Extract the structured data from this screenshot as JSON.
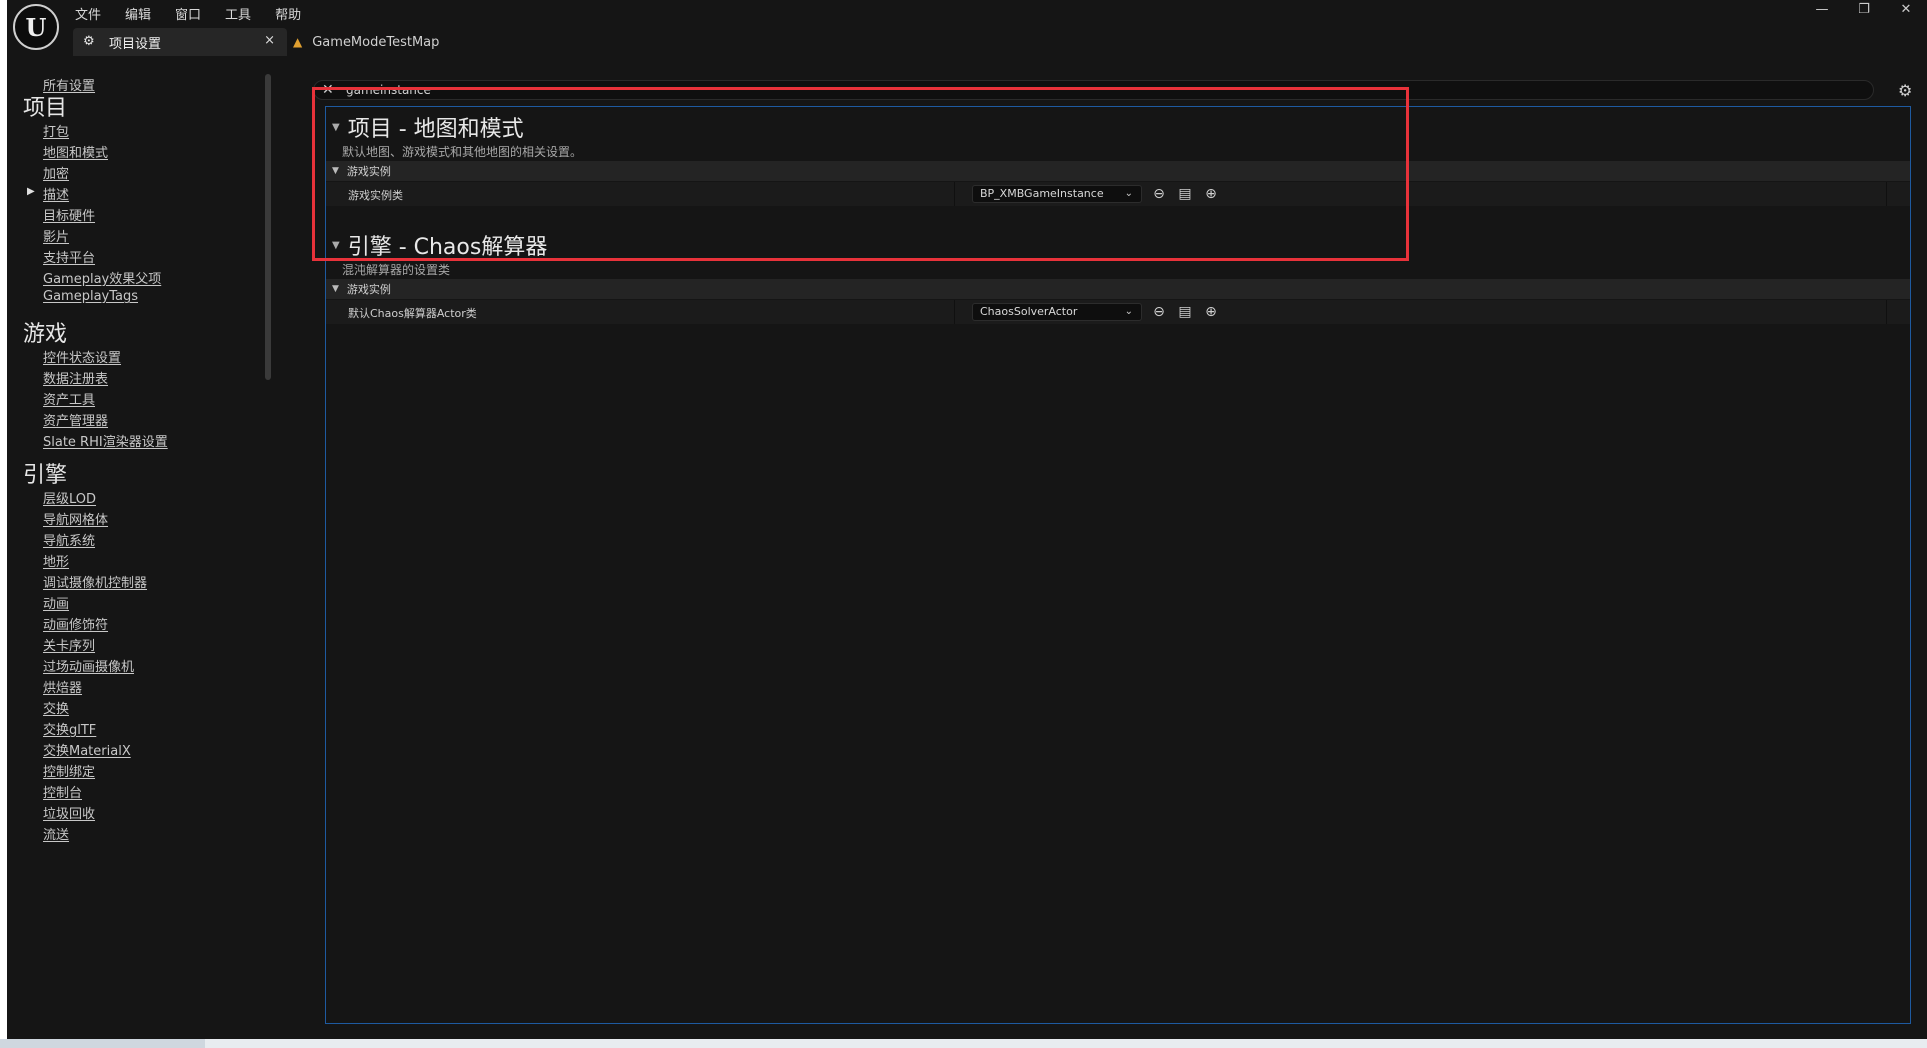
{
  "app": {
    "logo_text": "U"
  },
  "menu": [
    "文件",
    "编辑",
    "窗口",
    "工具",
    "帮助"
  ],
  "tabs": {
    "active": {
      "label": "项目设置",
      "close": "×"
    },
    "map": {
      "label": "GameModeTestMap"
    }
  },
  "window_controls": {
    "minimize": "—",
    "restore": "❐",
    "close": "✕"
  },
  "sidebar": {
    "all_settings": "所有设置",
    "project": {
      "heading": "项目",
      "items": [
        "打包",
        "地图和模式",
        "加密",
        "描述",
        "目标硬件",
        "影片",
        "支持平台",
        "Gameplay效果父项",
        "GameplayTags"
      ]
    },
    "game": {
      "heading": "游戏",
      "items": [
        "控件状态设置",
        "数据注册表",
        "资产工具",
        "资产管理器",
        "Slate RHI渲染器设置"
      ]
    },
    "engine": {
      "heading": "引擎",
      "items": [
        "层级LOD",
        "导航网格体",
        "导航系统",
        "地形",
        "调试摄像机控制器",
        "动画",
        "动画修饰符",
        "关卡序列",
        "过场动画摄像机",
        "烘焙器",
        "交换",
        "交换glTF",
        "交换MaterialX",
        "控制绑定",
        "控制台",
        "垃圾回收",
        "流送"
      ]
    }
  },
  "search": {
    "value": "gameinstance"
  },
  "sections": [
    {
      "title": "项目 - 地图和模式",
      "description": "默认地图、游戏模式和其他地图的相关设置。",
      "category": "游戏实例",
      "property": {
        "label": "游戏实例类",
        "value": "BP_XMBGameInstance"
      }
    },
    {
      "title": "引擎 - Chaos解算器",
      "description": "混沌解算器的设置类",
      "category": "游戏实例",
      "property": {
        "label": "默认Chaos解算器Actor类",
        "value": "ChaosSolverActor"
      }
    }
  ],
  "colors": {
    "highlight": "#e8323a",
    "panel_border": "#1e5aa0",
    "background": "#151515"
  }
}
